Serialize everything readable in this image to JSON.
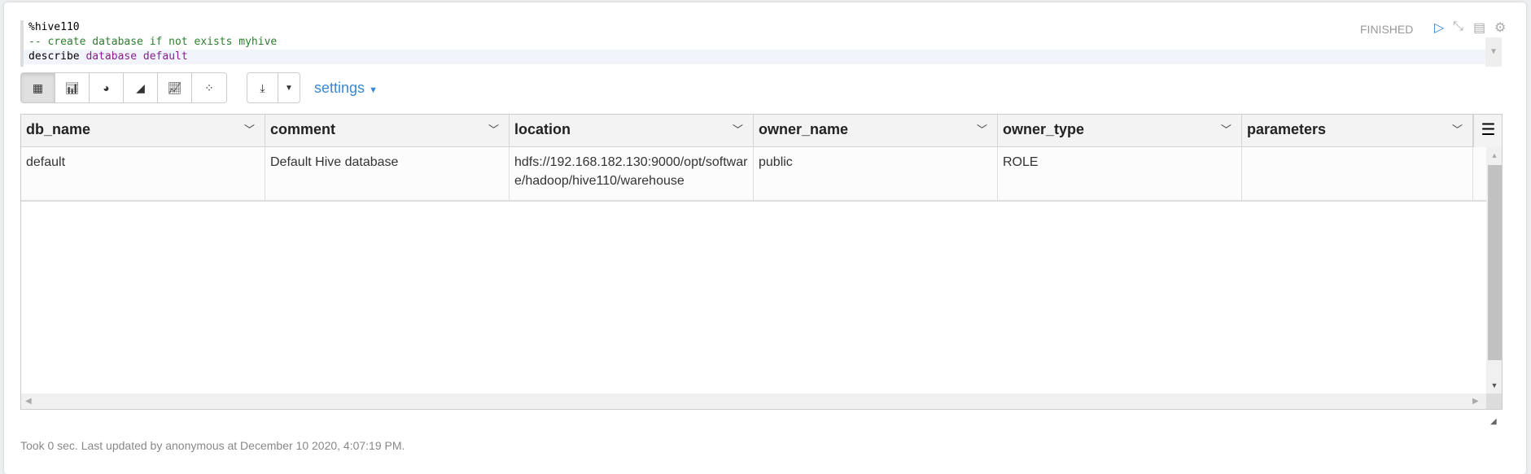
{
  "paragraph": {
    "code_lines": [
      {
        "text": "%hive110"
      },
      {
        "text": "-- create database if not exists myhive"
      },
      {
        "kw1": "describe ",
        "kw2": "database default"
      }
    ],
    "status": "FINISHED",
    "icons": [
      "run-icon",
      "collapse-icon",
      "book-icon",
      "gear-icon"
    ]
  },
  "toolbar": {
    "views": [
      "table",
      "bar-chart",
      "pie-chart",
      "area-chart",
      "line-chart",
      "scatter-chart"
    ],
    "active_view": "table",
    "settings_label": "settings"
  },
  "table": {
    "columns": [
      "db_name",
      "comment",
      "location",
      "owner_name",
      "owner_type",
      "parameters"
    ],
    "rows": [
      [
        "default",
        "Default Hive database",
        "hdfs://192.168.182.130:9000/opt/software/hadoop/hive110/warehouse",
        "public",
        "ROLE",
        ""
      ]
    ]
  },
  "footer": {
    "text": "Took 0 sec. Last updated by anonymous at December 10 2020, 4:07:19 PM."
  },
  "colors": {
    "accent": "#3a88d0",
    "status": "#999999",
    "comment": "#2f7d2f",
    "keyword": "#8a1e8e"
  }
}
